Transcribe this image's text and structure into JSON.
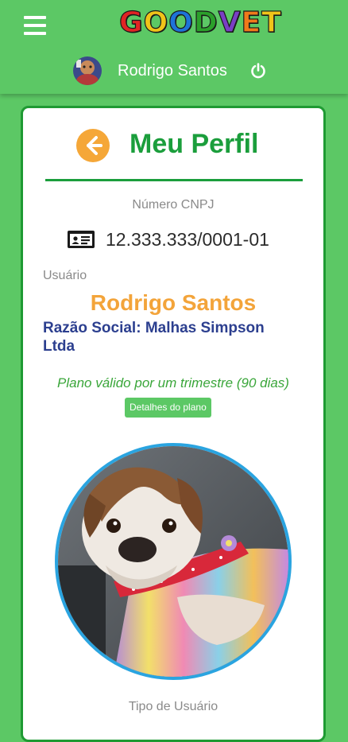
{
  "header": {
    "logo_text": [
      "G",
      "O",
      "O",
      "D",
      "V",
      "E",
      "T"
    ],
    "logo_colors": [
      "#e02424",
      "#f0c419",
      "#1e73d8",
      "#2ba02b",
      "#7a3fc4",
      "#f07a1a",
      "#f0c419"
    ],
    "user_name": "Rodrigo Santos"
  },
  "profile": {
    "title": "Meu Perfil",
    "cnpj_label": "Número CNPJ",
    "cnpj_value": "12.333.333/0001-01",
    "user_label": "Usuário",
    "user_name": "Rodrigo Santos",
    "razao_social": "Razão Social: Malhas Simpson Ltda",
    "plan_text": "Plano válido por um trimestre (90 dias)",
    "plan_button": "Detalhes do plano",
    "user_type_label": "Tipo de Usuário"
  },
  "colors": {
    "header_bg": "#5cc865",
    "card_border": "#1f9a33",
    "title": "#1b9e3c",
    "accent_orange": "#f3a43a",
    "razao_blue": "#2c3f8f",
    "photo_ring": "#2aa4e0"
  },
  "icons": {
    "menu": "hamburger-menu-icon",
    "power": "power-icon",
    "back": "back-arrow-icon",
    "id_card": "id-card-icon"
  }
}
